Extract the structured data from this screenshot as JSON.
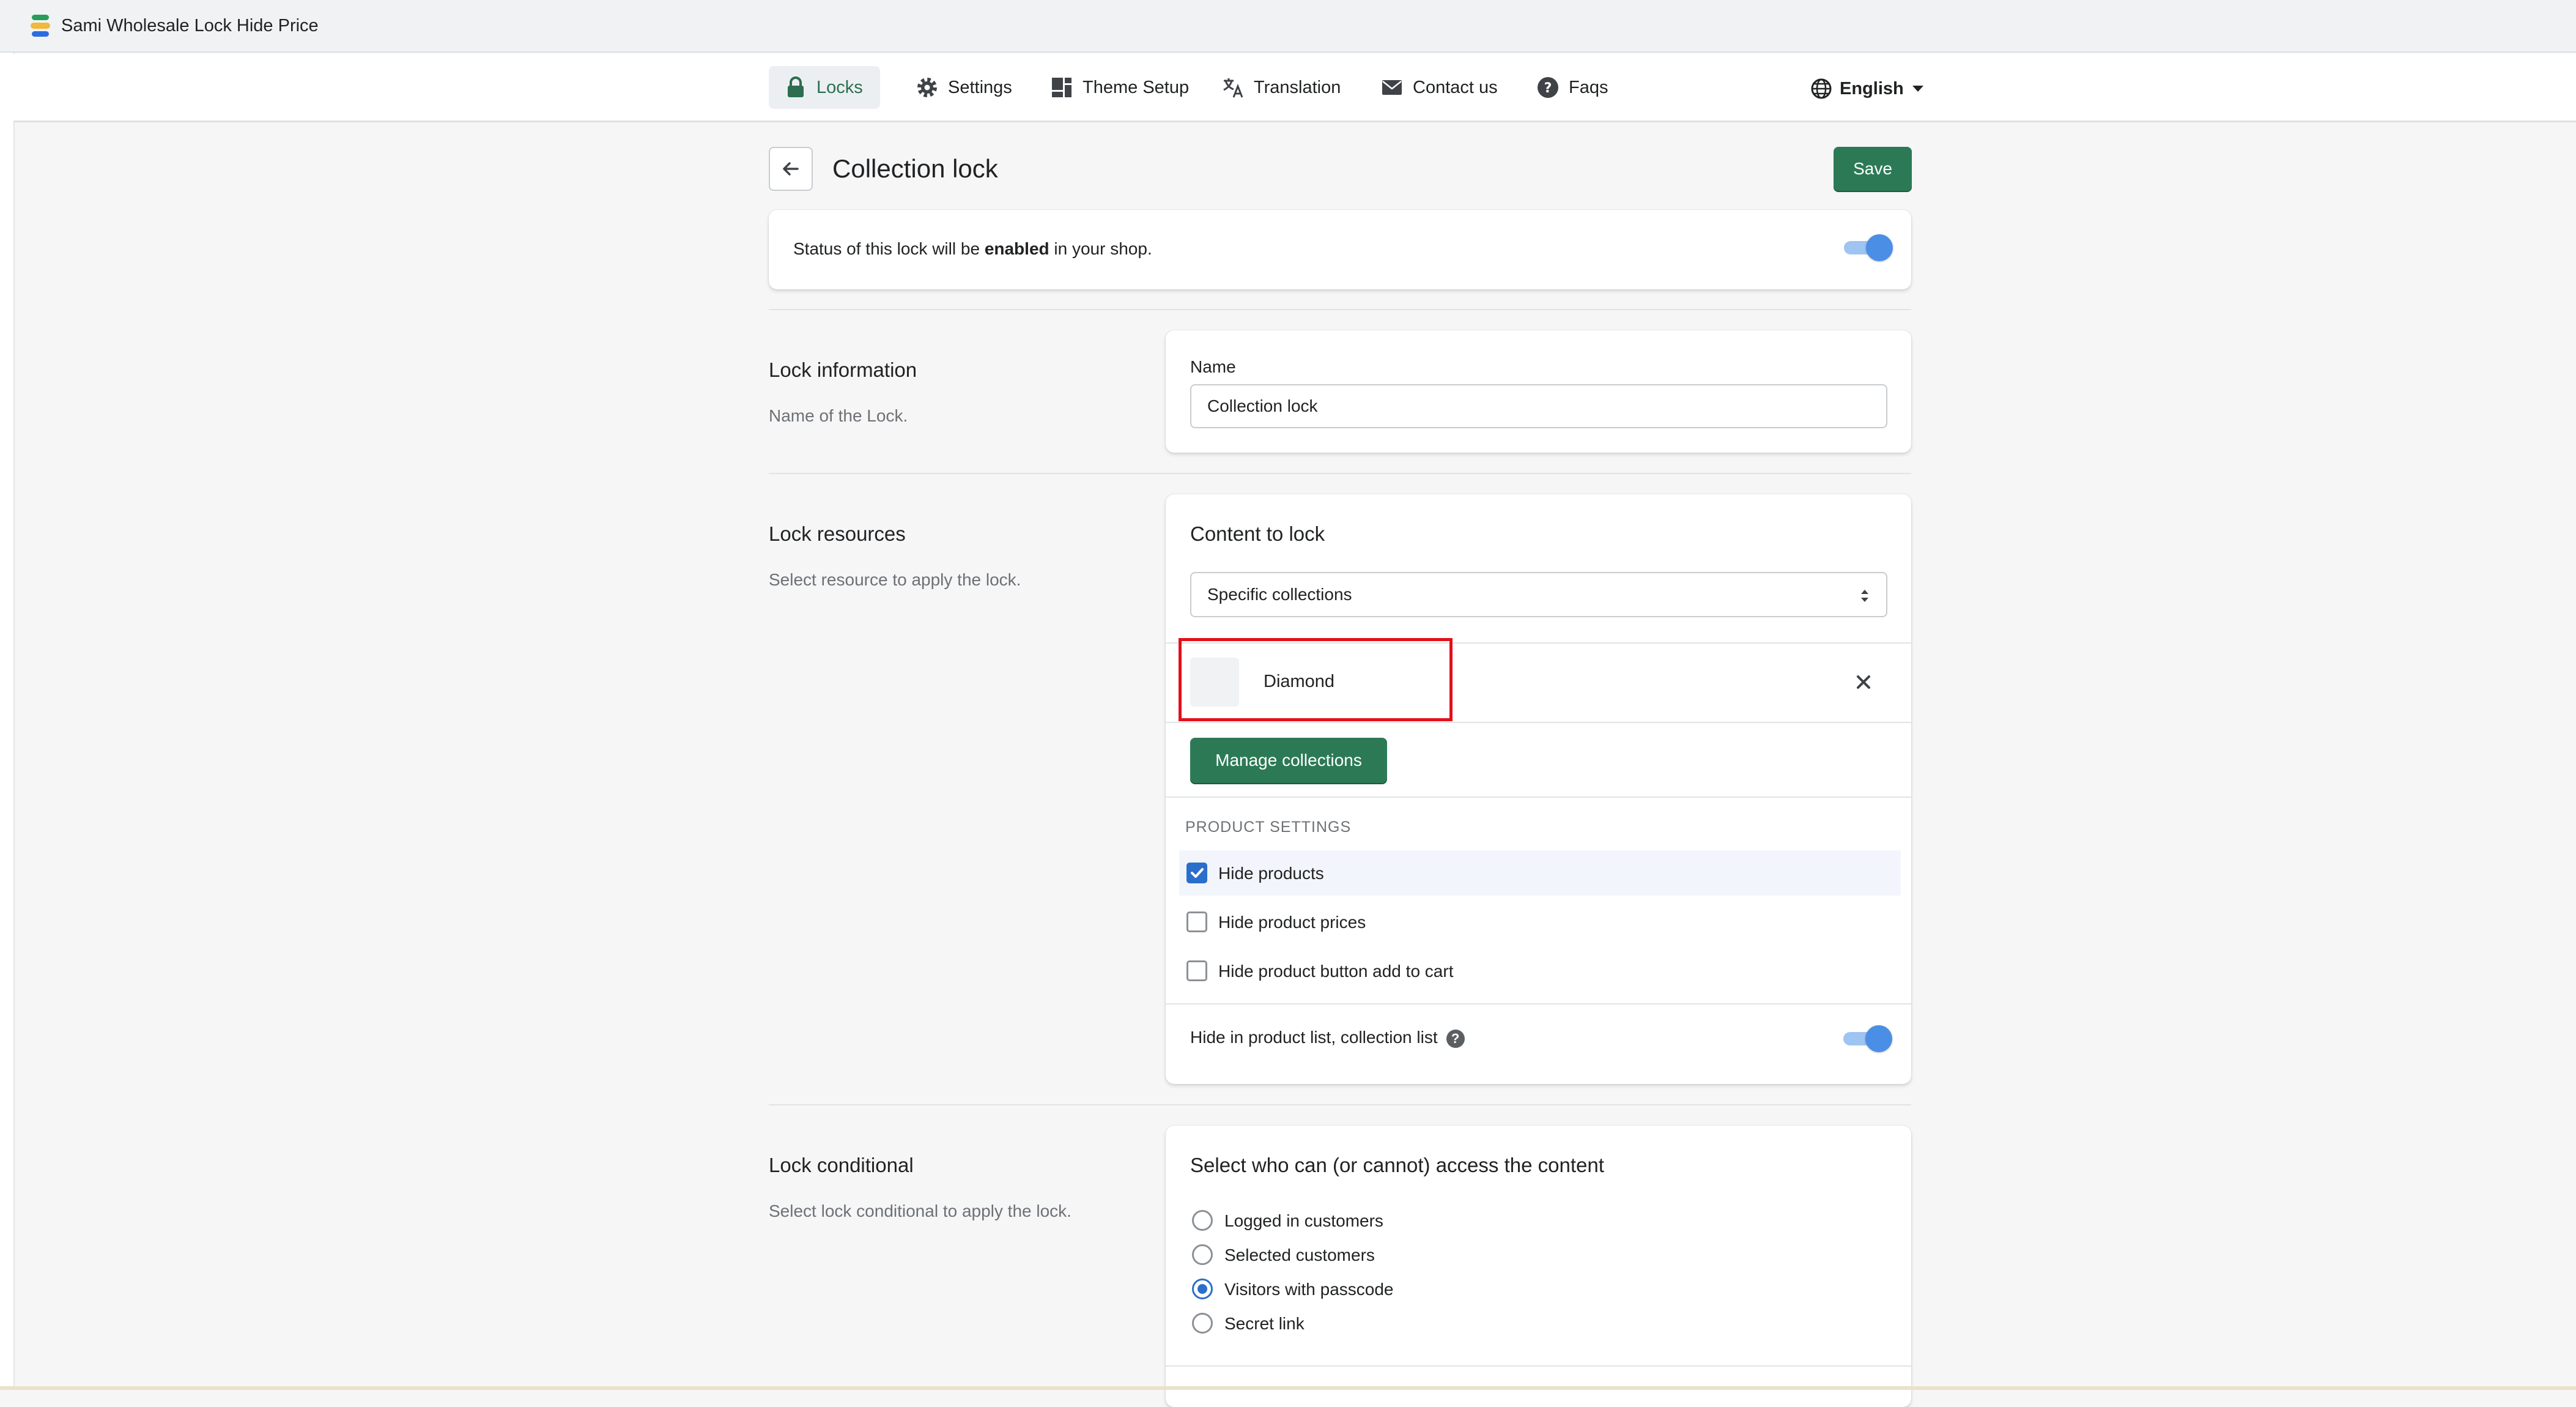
{
  "app": {
    "title": "Sami Wholesale Lock Hide Price"
  },
  "nav": {
    "items": [
      {
        "label": "Locks",
        "icon": "lock-icon",
        "active": true
      },
      {
        "label": "Settings",
        "icon": "gear-icon"
      },
      {
        "label": "Theme Setup",
        "icon": "theme-icon"
      },
      {
        "label": "Translation",
        "icon": "translate-icon"
      },
      {
        "label": "Contact us",
        "icon": "mail-icon"
      },
      {
        "label": "Faqs",
        "icon": "help-circle-icon"
      }
    ],
    "language": "English"
  },
  "page": {
    "title": "Collection lock",
    "save_label": "Save"
  },
  "status": {
    "prefix": "Status of this lock will be ",
    "state": "enabled",
    "suffix": " in your shop.",
    "enabled": true
  },
  "lock_info": {
    "title": "Lock information",
    "subtitle": "Name of the Lock.",
    "name_label": "Name",
    "name_value": "Collection lock"
  },
  "lock_resources": {
    "title": "Lock resources",
    "subtitle": "Select resource to apply the lock.",
    "content_heading": "Content to lock",
    "content_select": "Specific collections",
    "collections": [
      {
        "name": "Diamond"
      }
    ],
    "manage_label": "Manage collections",
    "product_settings_label": "PRODUCT SETTINGS",
    "options": [
      {
        "label": "Hide products",
        "checked": true
      },
      {
        "label": "Hide product prices",
        "checked": false
      },
      {
        "label": "Hide product button add to cart",
        "checked": false
      }
    ],
    "hide_in_list_label": "Hide in product list, collection list",
    "hide_in_list_enabled": true
  },
  "lock_conditional": {
    "title": "Lock conditional",
    "subtitle": "Select lock conditional to apply the lock.",
    "heading": "Select who can (or cannot) access the content",
    "options": [
      {
        "label": "Logged in customers",
        "selected": false
      },
      {
        "label": "Selected customers",
        "selected": false
      },
      {
        "label": "Visitors with passcode",
        "selected": true
      },
      {
        "label": "Secret link",
        "selected": false
      }
    ]
  }
}
